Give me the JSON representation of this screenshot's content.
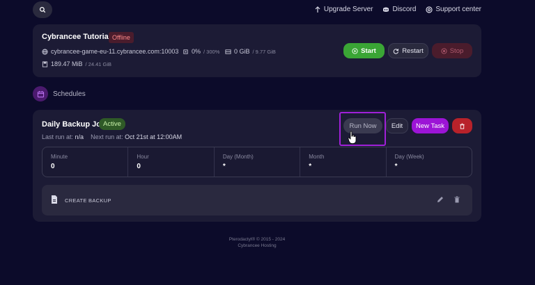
{
  "topbar": {
    "links": [
      {
        "label": "Upgrade Server",
        "icon": "arrow-up-icon"
      },
      {
        "label": "Discord",
        "icon": "discord-icon"
      },
      {
        "label": "Support center",
        "icon": "support-icon"
      }
    ]
  },
  "server": {
    "name": "Cybrancee Tutorials",
    "status": "Offline",
    "address": "cybrancee-game-eu-11.cybrancee.com:10003",
    "cpu_value": "0%",
    "cpu_limit": "/ 300%",
    "disk_value": "0 GiB",
    "disk_limit": "/ 9.77 GiB",
    "memory_value": "189.47 MiB",
    "memory_limit": "/ 24.41 GiB",
    "actions": {
      "start": "Start",
      "restart": "Restart",
      "stop": "Stop"
    }
  },
  "schedules": {
    "title": "Schedules",
    "job": {
      "name": "Daily Backup Job",
      "status": "Active",
      "last_run_label": "Last run at:",
      "last_run_value": "n/a",
      "next_run_label": "Next run at:",
      "next_run_value": "Oct 21st at 12:00AM",
      "actions": {
        "run_now": "Run Now",
        "edit": "Edit",
        "new_task": "New Task"
      },
      "cron": [
        {
          "label": "Minute",
          "value": "0"
        },
        {
          "label": "Hour",
          "value": "0"
        },
        {
          "label": "Day (Month)",
          "value": "*"
        },
        {
          "label": "Month",
          "value": "*"
        },
        {
          "label": "Day (Week)",
          "value": "*"
        }
      ],
      "tasks": [
        {
          "label": "CREATE BACKUP"
        }
      ]
    }
  },
  "footer": {
    "line1": "Pterodactyl® © 2015 - 2024",
    "line2": "Cybrancee Hosting"
  },
  "colors": {
    "background": "#0c0b2a",
    "card": "#1c1b35",
    "start_green": "#3aa535",
    "accent_purple": "#9c14d6",
    "danger_red": "#b8222a",
    "highlight_border": "#a020d8"
  }
}
